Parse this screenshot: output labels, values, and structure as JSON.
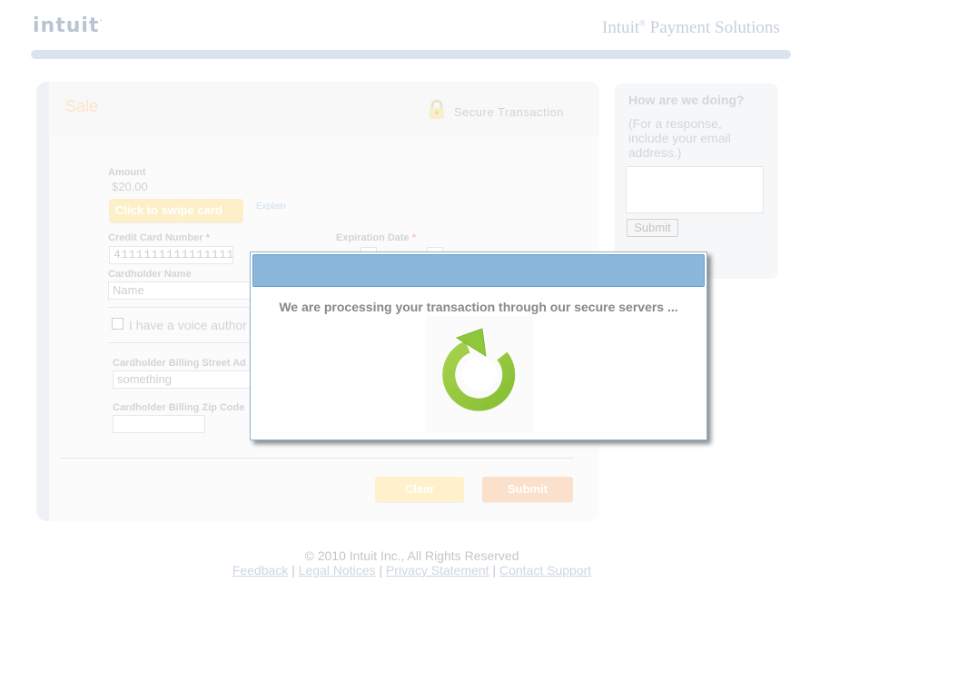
{
  "header": {
    "logo_text": "intuit",
    "logo_tm": ".",
    "brand_text": "Intuit",
    "brand_sup": "®",
    "brand_rest": " Payment Solutions"
  },
  "form": {
    "title": "Sale",
    "secure_label": "Secure Transaction",
    "amount_label": "Amount",
    "amount_value": "$20.00",
    "swipe_button": "Click to swipe card",
    "explain_link": "Explain",
    "cc_label": "Credit Card Number",
    "cc_value": "4111111111111111",
    "required_mark": "*",
    "exp_label": "Expiration Date",
    "name_label": "Cardholder Name",
    "name_placeholder": "Name",
    "voice_auth_label": "I have a voice author",
    "street_label": "Cardholder Billing Street Ad",
    "street_value": "something",
    "zip_label": "Cardholder Billing Zip Code",
    "zip_value": "",
    "clear_button": "Clear",
    "submit_button": "Submit"
  },
  "feedback": {
    "title": "How are we doing?",
    "hint": "(For a response, include your email address.)",
    "submit_button": "Submit"
  },
  "footer": {
    "copyright": "© 2010 Intuit Inc., All Rights Reserved",
    "links": [
      "Feedback",
      "Legal Notices",
      "Privacy Statement",
      "Contact Support"
    ],
    "separator": "|"
  },
  "modal": {
    "title": "",
    "message": "We are processing your transaction through our secure servers ...",
    "spinner_icon": "refresh-icon"
  },
  "colors": {
    "modal_title_bar": "#8bb7dc",
    "spinner_green": "#8cc63f"
  }
}
